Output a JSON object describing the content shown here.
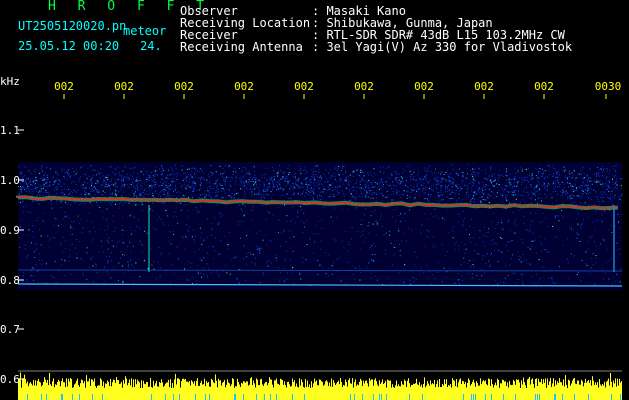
{
  "header": {
    "program": "H R O F F T",
    "filename": "UT2505120020.pn",
    "mode": "meteor",
    "datetime": "25.05.12 00:20",
    "count": "24."
  },
  "info": [
    {
      "label": "Observer",
      "value": ": Masaki Kano"
    },
    {
      "label": "Receiving Location",
      "value": ": Shibukawa, Gunma, Japan"
    },
    {
      "label": "Receiver",
      "value": ": RTL-SDR SDR# 43dB L15 103.2MHz CW"
    },
    {
      "label": "Receiving Antenna",
      "value": ": 3el Yagi(V) Az 330 for Vladivostok"
    }
  ],
  "axis": {
    "unit": "kHz",
    "y_ticks": [
      "1.1",
      "1.0",
      "0.9",
      "0.8",
      "0.7",
      "0.6"
    ],
    "x_ticks": [
      "002",
      "002",
      "002",
      "002",
      "002",
      "002",
      "002",
      "002",
      "002",
      "0030"
    ]
  },
  "colors": {
    "background": "#000000",
    "label": "#00ffff",
    "program": "#00ff44",
    "ticks": "#ffff00",
    "noise_base": "#0000aa",
    "signal": "#ff2020"
  }
}
